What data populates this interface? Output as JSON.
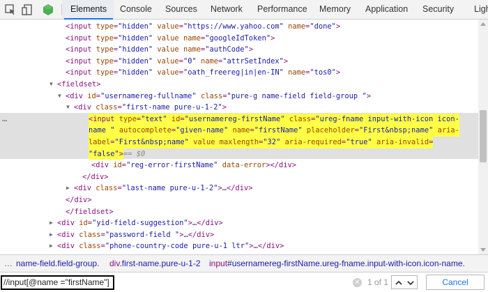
{
  "toolbar": {
    "tabs": [
      {
        "label": "Elements"
      },
      {
        "label": "Console"
      },
      {
        "label": "Sources"
      },
      {
        "label": "Network"
      },
      {
        "label": "Performance"
      },
      {
        "label": "Memory"
      },
      {
        "label": "Application"
      },
      {
        "label": "Security"
      },
      {
        "label": "Ligh"
      }
    ],
    "icons": [
      "inspect-element-icon",
      "device-toolbar-icon",
      "extension-icon"
    ]
  },
  "tree": {
    "lines": [
      {
        "tri": "",
        "parts": [
          [
            "tag",
            "<input "
          ],
          [
            "an",
            "type"
          ],
          [
            "eq",
            "="
          ],
          [
            "av",
            "\"hidden\""
          ],
          [
            "pl",
            " "
          ],
          [
            "an",
            "value"
          ],
          [
            "eq",
            "="
          ],
          [
            "av",
            "\"https://www.yahoo.com\""
          ],
          [
            "pl",
            " "
          ],
          [
            "an",
            "name"
          ],
          [
            "eq",
            "="
          ],
          [
            "av",
            "\"done\""
          ],
          [
            "tag",
            ">"
          ]
        ]
      },
      {
        "tri": "",
        "parts": [
          [
            "tag",
            "<input "
          ],
          [
            "an",
            "type"
          ],
          [
            "eq",
            "="
          ],
          [
            "av",
            "\"hidden\""
          ],
          [
            "pl",
            " "
          ],
          [
            "an",
            "value"
          ],
          [
            "pl",
            " "
          ],
          [
            "an",
            "name"
          ],
          [
            "eq",
            "="
          ],
          [
            "av",
            "\"googleIdToken\""
          ],
          [
            "tag",
            ">"
          ]
        ]
      },
      {
        "tri": "",
        "parts": [
          [
            "tag",
            "<input "
          ],
          [
            "an",
            "type"
          ],
          [
            "eq",
            "="
          ],
          [
            "av",
            "\"hidden\""
          ],
          [
            "pl",
            " "
          ],
          [
            "an",
            "value"
          ],
          [
            "pl",
            " "
          ],
          [
            "an",
            "name"
          ],
          [
            "eq",
            "="
          ],
          [
            "av",
            "\"authCode\""
          ],
          [
            "tag",
            ">"
          ]
        ]
      },
      {
        "tri": "",
        "parts": [
          [
            "tag",
            "<input "
          ],
          [
            "an",
            "type"
          ],
          [
            "eq",
            "="
          ],
          [
            "av",
            "\"hidden\""
          ],
          [
            "pl",
            " "
          ],
          [
            "an",
            "value"
          ],
          [
            "eq",
            "="
          ],
          [
            "av",
            "\"0\""
          ],
          [
            "pl",
            " "
          ],
          [
            "an",
            "name"
          ],
          [
            "eq",
            "="
          ],
          [
            "av",
            "\"attrSetIndex\""
          ],
          [
            "tag",
            ">"
          ]
        ]
      },
      {
        "tri": "",
        "parts": [
          [
            "tag",
            "<input "
          ],
          [
            "an",
            "type"
          ],
          [
            "eq",
            "="
          ],
          [
            "av",
            "\"hidden\""
          ],
          [
            "pl",
            " "
          ],
          [
            "an",
            "value"
          ],
          [
            "eq",
            "="
          ],
          [
            "av",
            "\"oath_freereg|in|en-IN\""
          ],
          [
            "pl",
            " "
          ],
          [
            "an",
            "name"
          ],
          [
            "eq",
            "="
          ],
          [
            "av",
            "\"tos0\""
          ],
          [
            "tag",
            ">"
          ]
        ]
      },
      {
        "tri": "▼",
        "parts": [
          [
            "tag",
            "<fieldset>"
          ]
        ]
      },
      {
        "tri": "▼",
        "parts": [
          [
            "tag",
            "<div "
          ],
          [
            "an",
            "id"
          ],
          [
            "eq",
            "="
          ],
          [
            "av",
            "\"usernamereg-fullname\""
          ],
          [
            "pl",
            " "
          ],
          [
            "an",
            "class"
          ],
          [
            "eq",
            "="
          ],
          [
            "av",
            "\"pure-g name-field field-group  \""
          ],
          [
            "tag",
            ">"
          ]
        ]
      },
      {
        "tri": "▼",
        "parts": [
          [
            "tag",
            "<div "
          ],
          [
            "an",
            "class"
          ],
          [
            "eq",
            "="
          ],
          [
            "av",
            "\"first-name pure-u-1-2\""
          ],
          [
            "tag",
            ">"
          ]
        ]
      },
      {
        "tri": "",
        "hl": true,
        "parts": [
          [
            "tag",
            "<input "
          ],
          [
            "an",
            "type"
          ],
          [
            "eq",
            "="
          ],
          [
            "av",
            "\"text\""
          ],
          [
            "pl",
            " "
          ],
          [
            "an",
            "id"
          ],
          [
            "eq",
            "="
          ],
          [
            "av",
            "\"usernamereg-firstName\""
          ],
          [
            "pl",
            " "
          ],
          [
            "an",
            "class"
          ],
          [
            "eq",
            "="
          ],
          [
            "av",
            "\"ureg-fname input-with-icon icon-"
          ]
        ]
      },
      {
        "tri": "",
        "hl": true,
        "parts": [
          [
            "av",
            "name \""
          ],
          [
            "pl",
            " "
          ],
          [
            "an",
            "autocomplete"
          ],
          [
            "eq",
            "="
          ],
          [
            "av",
            "\"given-name\""
          ],
          [
            "pl",
            " "
          ],
          [
            "an",
            "name"
          ],
          [
            "eq",
            "="
          ],
          [
            "av",
            "\"firstName\""
          ],
          [
            "pl",
            " "
          ],
          [
            "an",
            "placeholder"
          ],
          [
            "eq",
            "="
          ],
          [
            "av",
            "\"First&nbsp;name\""
          ],
          [
            "pl",
            " "
          ],
          [
            "an",
            "aria-"
          ]
        ]
      },
      {
        "tri": "",
        "hl": true,
        "parts": [
          [
            "an",
            "label"
          ],
          [
            "eq",
            "="
          ],
          [
            "av",
            "\"First&nbsp;name\""
          ],
          [
            "pl",
            " "
          ],
          [
            "an",
            "value"
          ],
          [
            "pl",
            " "
          ],
          [
            "an",
            "maxlength"
          ],
          [
            "eq",
            "="
          ],
          [
            "av",
            "\"32\""
          ],
          [
            "pl",
            " "
          ],
          [
            "an",
            "aria-required"
          ],
          [
            "eq",
            "="
          ],
          [
            "av",
            "\"true\""
          ],
          [
            "pl",
            " "
          ],
          [
            "an",
            "aria-invalid"
          ],
          [
            "eq",
            "="
          ]
        ]
      },
      {
        "tri": "",
        "hl": true,
        "ref": " == $0",
        "parts": [
          [
            "av",
            "\"false\""
          ],
          [
            "tag",
            ">"
          ]
        ]
      },
      {
        "tri": "",
        "parts": [
          [
            "tag",
            "<div "
          ],
          [
            "an",
            "id"
          ],
          [
            "eq",
            "="
          ],
          [
            "av",
            "\"reg-error-firstName\""
          ],
          [
            "pl",
            " "
          ],
          [
            "an",
            "data-error"
          ],
          [
            "tag",
            ">"
          ],
          [
            "tag",
            "</div>"
          ]
        ]
      },
      {
        "tri": "",
        "parts": [
          [
            "tag",
            "</div>"
          ]
        ]
      },
      {
        "tri": "▶",
        "parts": [
          [
            "tag",
            "<div "
          ],
          [
            "an",
            "class"
          ],
          [
            "eq",
            "="
          ],
          [
            "av",
            "\"last-name pure-u-1-2\""
          ],
          [
            "tag",
            ">"
          ],
          [
            "pl",
            "…"
          ],
          [
            "tag",
            "</div>"
          ]
        ]
      },
      {
        "tri": "",
        "parts": [
          [
            "tag",
            "</div>"
          ]
        ]
      },
      {
        "tri": "",
        "parts": [
          [
            "tag",
            "</fieldset>"
          ]
        ]
      },
      {
        "tri": "▶",
        "parts": [
          [
            "tag",
            "<div "
          ],
          [
            "an",
            "id"
          ],
          [
            "eq",
            "="
          ],
          [
            "av",
            "\"yid-field-suggestion\""
          ],
          [
            "tag",
            ">"
          ],
          [
            "pl",
            "…"
          ],
          [
            "tag",
            "</div>"
          ]
        ]
      },
      {
        "tri": "▶",
        "parts": [
          [
            "tag",
            "<div "
          ],
          [
            "an",
            "class"
          ],
          [
            "eq",
            "="
          ],
          [
            "av",
            "\"password-field \""
          ],
          [
            "tag",
            ">"
          ],
          [
            "pl",
            "…"
          ],
          [
            "tag",
            "</div>"
          ]
        ]
      },
      {
        "tri": "▶",
        "parts": [
          [
            "tag",
            "<div "
          ],
          [
            "an",
            "class"
          ],
          [
            "eq",
            "="
          ],
          [
            "av",
            "\"phone-country-code pure-u-1 ltr\""
          ],
          [
            "tag",
            ">"
          ],
          [
            "pl",
            "…"
          ],
          [
            "tag",
            "</div>"
          ]
        ]
      }
    ],
    "dots": "…"
  },
  "breadcrumb": {
    "dots": "…",
    "items": [
      {
        "tag": "",
        "rest": "name-field.field-group."
      },
      {
        "tag": "div",
        "rest": ".first-name.pure-u-1-2"
      },
      {
        "tag": "input",
        "rest": "#usernamereg-firstName.ureg-fname.input-with-icon.icon-name."
      }
    ]
  },
  "search": {
    "value": "//input[@name =\"firstName\"]",
    "match_count": "1 of 1",
    "cancel_label": "Cancel"
  },
  "colors": {
    "tag": "#881280",
    "attr_name": "#994500",
    "attr_value": "#1a1aa6",
    "highlight": "#ffff46",
    "accent": "#1a73e8"
  }
}
